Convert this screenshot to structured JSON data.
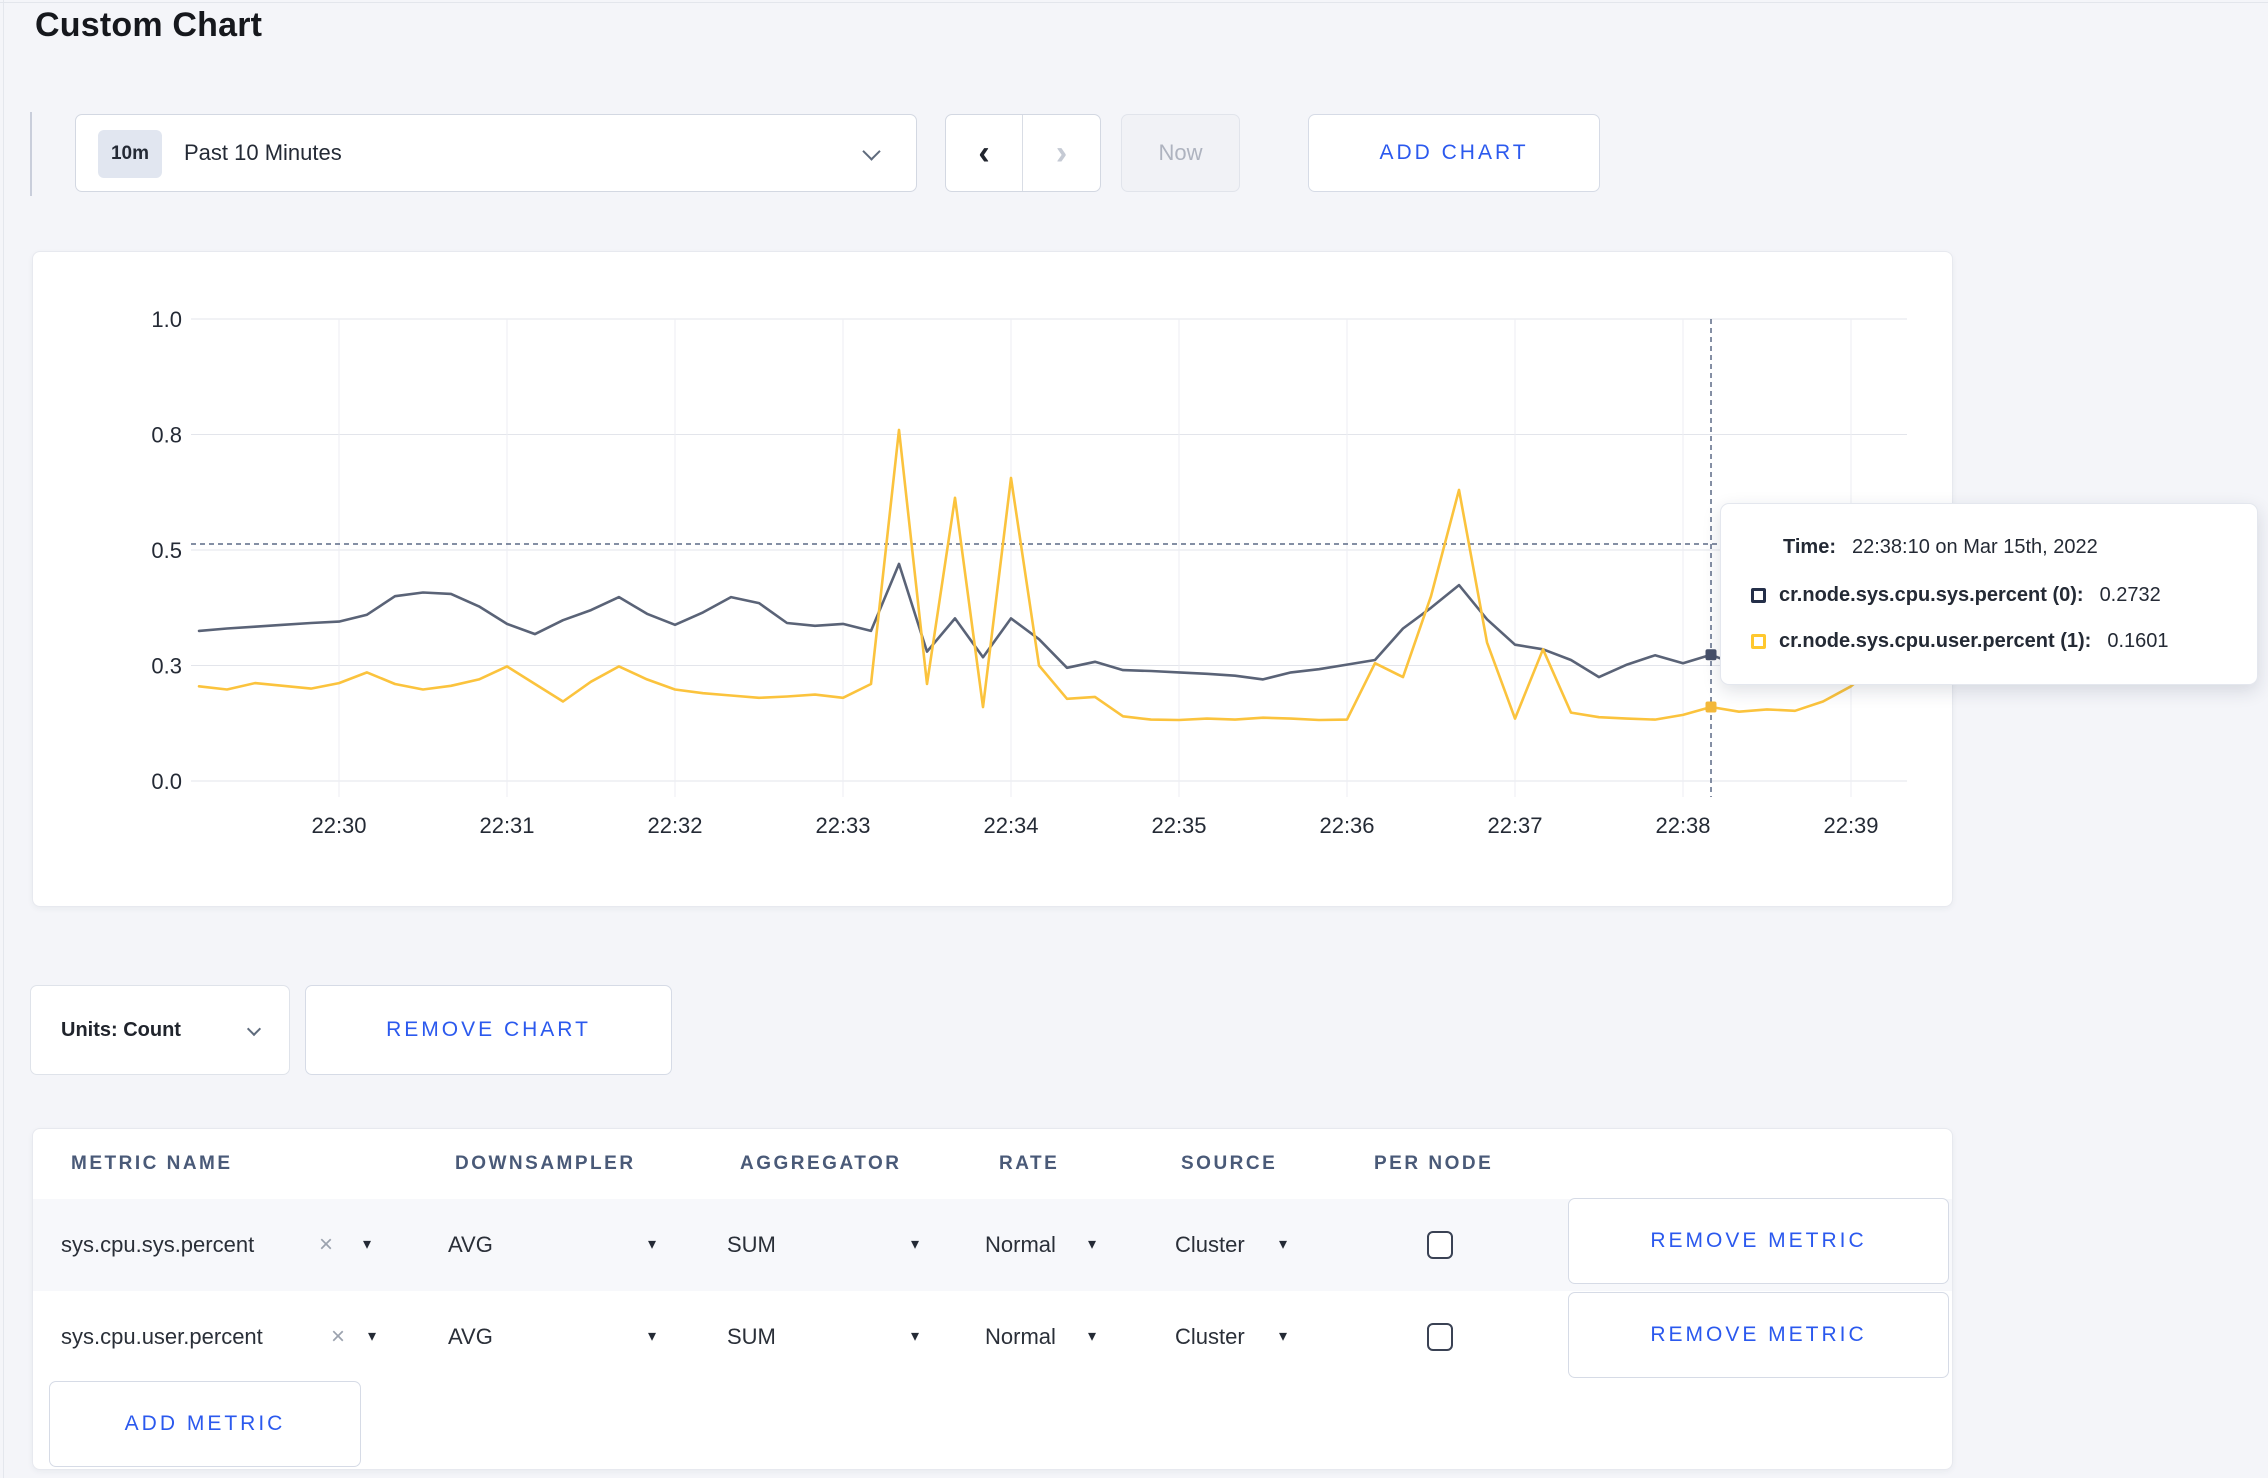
{
  "page": {
    "title": "Custom Chart"
  },
  "toolbar": {
    "time_range_badge": "10m",
    "time_range_label": "Past 10 Minutes",
    "now_label": "Now",
    "add_chart_label": "ADD CHART"
  },
  "icons": {
    "prev_arrow": "‹",
    "next_arrow": "›",
    "dropdown_triangle": "▾",
    "remove_x": "×"
  },
  "colors": {
    "accent_blue": "#2b59ee",
    "series_sys": "#5a6377",
    "series_user": "#fbc33d",
    "page_background": "#f4f5f9",
    "header_slate": "#4a5a78",
    "text_dark": "#242a35"
  },
  "chart_data": {
    "type": "line",
    "title": "",
    "x_start": "22:29:10",
    "x_interval_seconds": 10,
    "x_start_offset_min": -0.8333,
    "x_ticks": [
      "22:30",
      "22:31",
      "22:32",
      "22:33",
      "22:34",
      "22:35",
      "22:36",
      "22:37",
      "22:38",
      "22:39"
    ],
    "y_ticks": [
      {
        "value": 1.0,
        "label": "1.0"
      },
      {
        "value": 0.75,
        "label": "0.8"
      },
      {
        "value": 0.5,
        "label": "0.5"
      },
      {
        "value": 0.25,
        "label": "0.3"
      },
      {
        "value": 0.0,
        "label": "0.0"
      }
    ],
    "ylim": [
      0,
      1
    ],
    "grid": true,
    "legend_position": "tooltip",
    "series": [
      {
        "name": "cr.node.sys.cpu.sys.percent",
        "color": "#5a6377",
        "values": [
          0.325,
          0.33,
          0.334,
          0.338,
          0.342,
          0.345,
          0.36,
          0.4,
          0.408,
          0.405,
          0.378,
          0.34,
          0.318,
          0.348,
          0.37,
          0.398,
          0.362,
          0.338,
          0.365,
          0.398,
          0.385,
          0.342,
          0.336,
          0.34,
          0.325,
          0.47,
          0.28,
          0.352,
          0.268,
          0.352,
          0.307,
          0.245,
          0.258,
          0.24,
          0.238,
          0.235,
          0.232,
          0.228,
          0.22,
          0.235,
          0.242,
          0.252,
          0.262,
          0.33,
          0.375,
          0.424,
          0.35,
          0.295,
          0.285,
          0.262,
          0.225,
          0.252,
          0.272,
          0.255,
          0.2732,
          0.25,
          0.262,
          0.255,
          0.258,
          0.255,
          0.258,
          0.255
        ]
      },
      {
        "name": "cr.node.sys.cpu.user.percent",
        "color": "#fbc33d",
        "values": [
          0.205,
          0.198,
          0.212,
          0.206,
          0.2,
          0.212,
          0.235,
          0.21,
          0.198,
          0.206,
          0.22,
          0.248,
          0.21,
          0.172,
          0.215,
          0.248,
          0.22,
          0.198,
          0.19,
          0.185,
          0.18,
          0.183,
          0.187,
          0.18,
          0.21,
          0.76,
          0.21,
          0.613,
          0.16,
          0.656,
          0.25,
          0.178,
          0.182,
          0.14,
          0.133,
          0.132,
          0.135,
          0.133,
          0.137,
          0.135,
          0.132,
          0.133,
          0.255,
          0.225,
          0.4,
          0.63,
          0.3,
          0.135,
          0.285,
          0.148,
          0.138,
          0.135,
          0.133,
          0.143,
          0.1601,
          0.15,
          0.155,
          0.152,
          0.172,
          0.205,
          0.255,
          0.22
        ]
      }
    ],
    "crosshair": {
      "time": "22:38:10",
      "x_offset_min": 8.1667,
      "y_value": 0.513,
      "markers": [
        {
          "series": "cr.node.sys.cpu.sys.percent",
          "value": 0.2732,
          "color": "#46506a"
        },
        {
          "series": "cr.node.sys.cpu.user.percent",
          "value": 0.1601,
          "color": "#f3b83a"
        }
      ]
    }
  },
  "tooltip": {
    "time_label": "Time:",
    "time_value": "22:38:10 on Mar 15th, 2022",
    "rows": [
      {
        "label": "cr.node.sys.cpu.sys.percent (0):",
        "value": "0.2732",
        "color": "#242f49"
      },
      {
        "label": "cr.node.sys.cpu.user.percent (1):",
        "value": "0.1601",
        "color": "#ffc82e"
      }
    ]
  },
  "units_row": {
    "units_label": "Units: Count",
    "remove_chart_label": "REMOVE CHART"
  },
  "table": {
    "headers": [
      "METRIC NAME",
      "DOWNSAMPLER",
      "AGGREGATOR",
      "RATE",
      "SOURCE",
      "PER NODE"
    ],
    "rows": [
      {
        "metric": "sys.cpu.sys.percent",
        "downsampler": "AVG",
        "aggregator": "SUM",
        "rate": "Normal",
        "source": "Cluster",
        "per_node_checked": false,
        "remove_label": "REMOVE METRIC"
      },
      {
        "metric": "sys.cpu.user.percent",
        "downsampler": "AVG",
        "aggregator": "SUM",
        "rate": "Normal",
        "source": "Cluster",
        "per_node_checked": false,
        "remove_label": "REMOVE METRIC"
      }
    ],
    "add_metric_label": "ADD METRIC"
  }
}
